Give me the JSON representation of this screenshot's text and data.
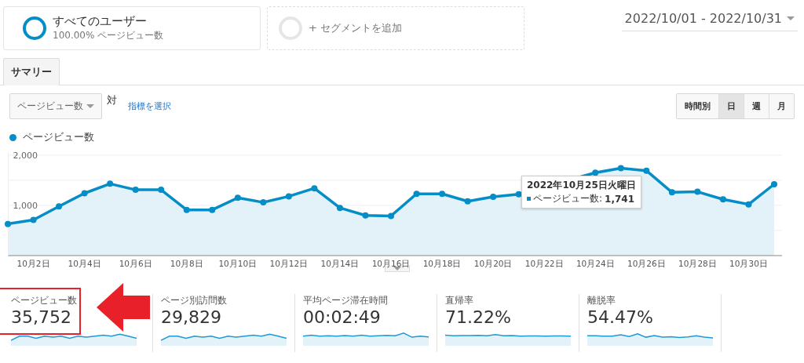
{
  "segments": [
    {
      "title": "すべてのユーザー",
      "subtitle": "100.00% ページビュー数",
      "kind": "active"
    },
    {
      "title": "+ セグメントを追加",
      "kind": "add"
    }
  ],
  "date_range": "2022/10/01 - 2022/10/31",
  "tabs": [
    {
      "label": "サマリー",
      "selected": true
    }
  ],
  "metric_selector": {
    "value": "ページビュー数",
    "versus": "対",
    "link": "指標を選択"
  },
  "granularity": [
    {
      "label": "時間別",
      "selected": false
    },
    {
      "label": "日",
      "selected": true
    },
    {
      "label": "週",
      "selected": false
    },
    {
      "label": "月",
      "selected": false
    }
  ],
  "chart": {
    "tooltip": {
      "title": "2022年10月25日火曜日",
      "label": "ページビュー数:",
      "value": "1,741"
    },
    "chart_data": {
      "type": "area",
      "categories": [
        null,
        "10月2日",
        null,
        "10月4日",
        null,
        "10月6日",
        null,
        "10月8日",
        null,
        "10月10日",
        null,
        "10月12日",
        null,
        "10月14日",
        null,
        "10月16日",
        null,
        "10月18日",
        null,
        "10月20日",
        null,
        "10月22日",
        null,
        "10月24日",
        null,
        "10月26日",
        null,
        "10月28日",
        null,
        "10月30日",
        null
      ],
      "series": [
        {
          "name": "ページビュー数",
          "color": "#058dc7",
          "values": [
            630,
            710,
            980,
            1240,
            1430,
            1310,
            1310,
            910,
            910,
            1150,
            1060,
            1180,
            1340,
            950,
            800,
            790,
            1230,
            1230,
            1080,
            1170,
            1220,
            null,
            null,
            1650,
            1740,
            1690,
            1260,
            1270,
            1120,
            1020,
            1420
          ]
        }
      ],
      "ylim": [
        0,
        2060
      ],
      "yticks": [
        {
          "value": 1000,
          "label": "1,000"
        },
        {
          "value": 2000,
          "label": "2,000"
        }
      ]
    }
  },
  "metrics": [
    {
      "label": "ページビュー数",
      "value": "35,752",
      "selected": true
    },
    {
      "label": "ページ別訪問数",
      "value": "29,829",
      "selected": false
    },
    {
      "label": "平均ページ滞在時間",
      "value": "00:02:49",
      "selected": false
    },
    {
      "label": "直帰率",
      "value": "71.22%",
      "selected": false
    },
    {
      "label": "離脱率",
      "value": "54.47%",
      "selected": false
    }
  ]
}
